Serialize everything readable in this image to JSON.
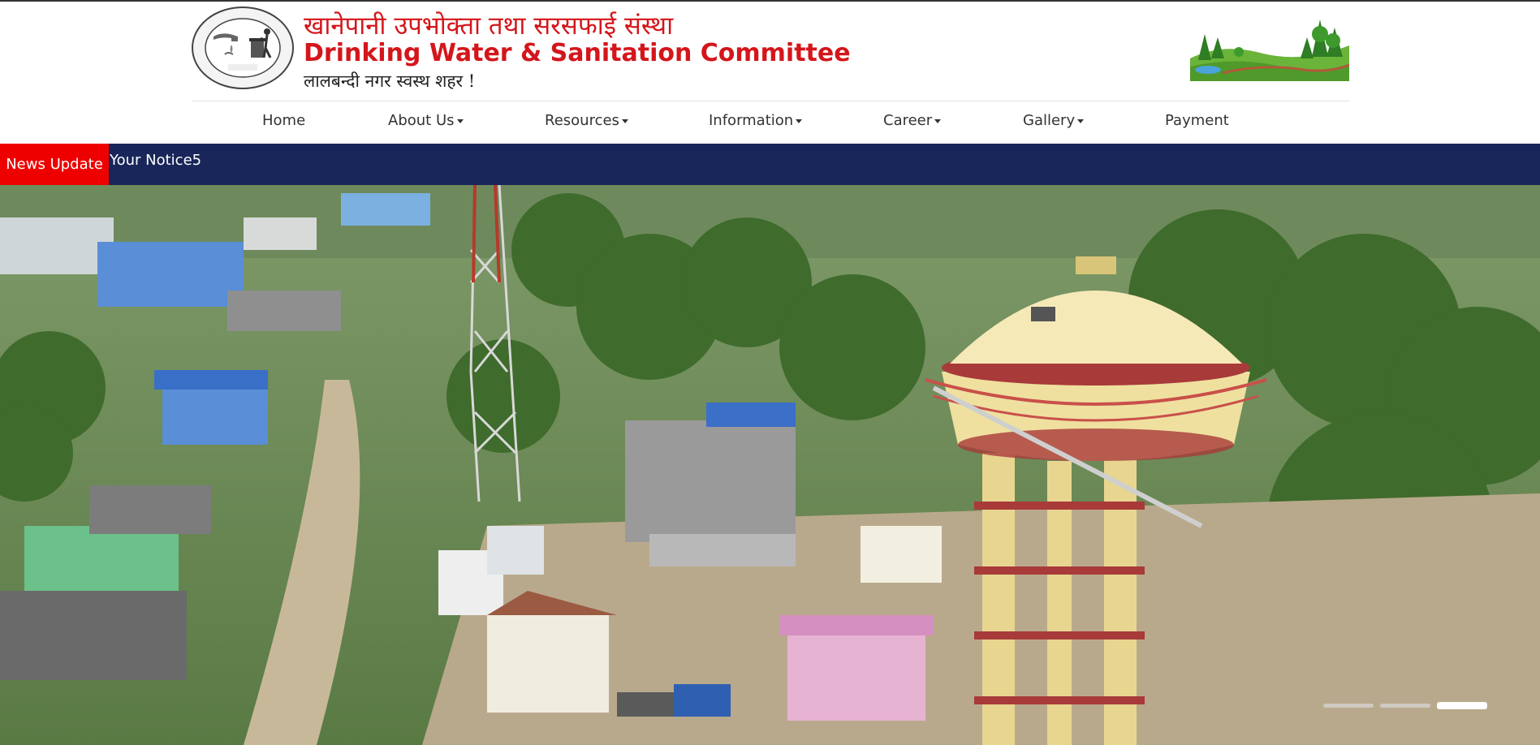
{
  "header": {
    "title_nepali": "खानेपानी उपभोक्ता तथा सरसफाई संस्था",
    "title_english": "Drinking Water & Sanitation Committee",
    "slogan": "लालबन्दी नगर स्वस्थ शहर !",
    "logo_icon": "water-sanitation-seal-icon",
    "landscape_icon": "green-landscape-icon",
    "brand_color": "#d4161b"
  },
  "nav": {
    "items": [
      {
        "label": "Home",
        "dropdown": false
      },
      {
        "label": "About Us",
        "dropdown": true
      },
      {
        "label": "Resources",
        "dropdown": true
      },
      {
        "label": "Information",
        "dropdown": true
      },
      {
        "label": "Career",
        "dropdown": true
      },
      {
        "label": "Gallery",
        "dropdown": true
      },
      {
        "label": "Payment",
        "dropdown": false
      }
    ]
  },
  "news": {
    "label": "News Update",
    "text": "Your Notice5",
    "label_color": "#ee0000",
    "bar_color": "#182659"
  },
  "carousel": {
    "slide_count": 3,
    "active_index": 2
  }
}
